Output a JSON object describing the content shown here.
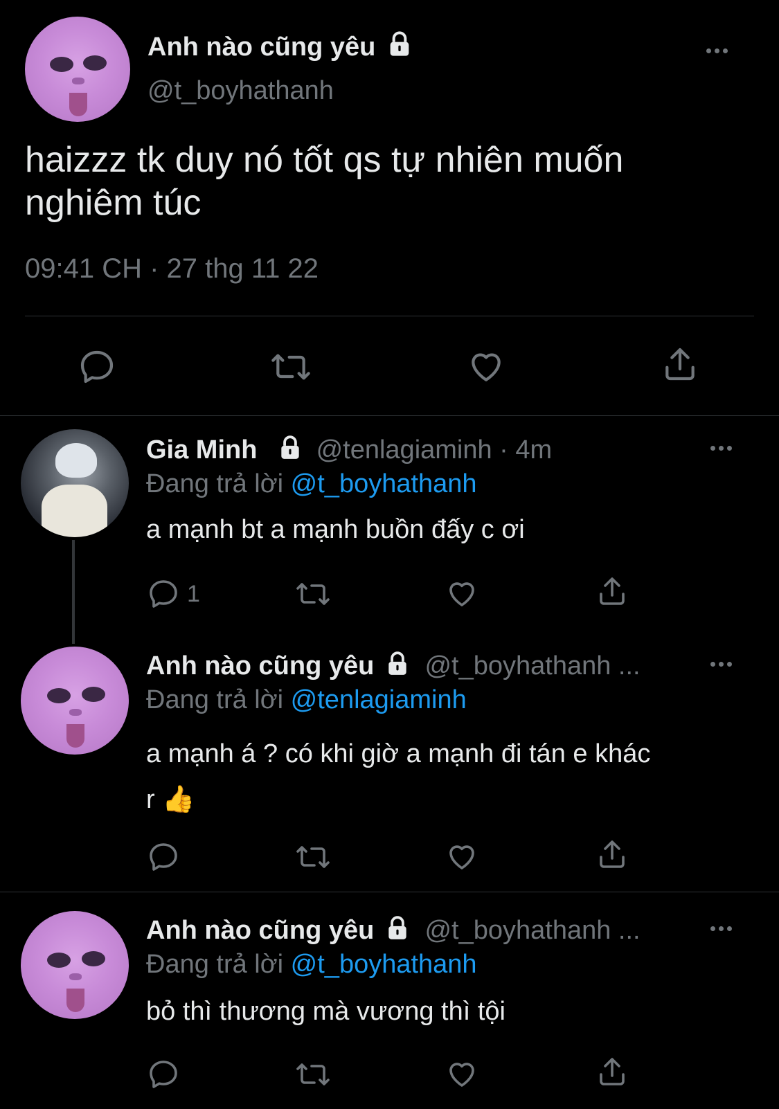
{
  "main_tweet": {
    "display_name": "Anh nào cũng yêu",
    "handle": "@t_boyhathanh",
    "text_line1": "haizzz tk duy nó tốt qs tự nhiên muốn",
    "text_line2": "nghiêm túc",
    "timestamp": "09:41 CH · 27 thg 11 22"
  },
  "replies": [
    {
      "display_name": "Gia Minh",
      "handle_time": "@tenlagiaminh · 4m",
      "replying_prefix": "Đang trả lời",
      "replying_to": "@t_boyhathanh",
      "text": "a mạnh bt a mạnh buồn đấy c ơi",
      "reply_count": "1"
    },
    {
      "display_name": "Anh nào cũng yêu",
      "handle_time": "@t_boyhathanh ...",
      "replying_prefix": "Đang trả lời",
      "replying_to": "@tenlagiaminh",
      "text_line1": "a mạnh á ? có khi giờ a mạnh đi tán e khác",
      "text_line2": "r 👍"
    },
    {
      "display_name": "Anh nào cũng yêu",
      "handle_time": "@t_boyhathanh ...",
      "replying_prefix": "Đang trả lời",
      "replying_to": "@t_boyhathanh",
      "text": "bỏ thì thương mà vương thì tội"
    }
  ],
  "colors": {
    "background": "#000000",
    "text": "#e7e9ea",
    "secondary": "#71767b",
    "link": "#1d9bf0",
    "divider": "#2f3336"
  },
  "icons": [
    "lock-icon",
    "more-icon",
    "reply-icon",
    "retweet-icon",
    "like-icon",
    "share-icon"
  ]
}
